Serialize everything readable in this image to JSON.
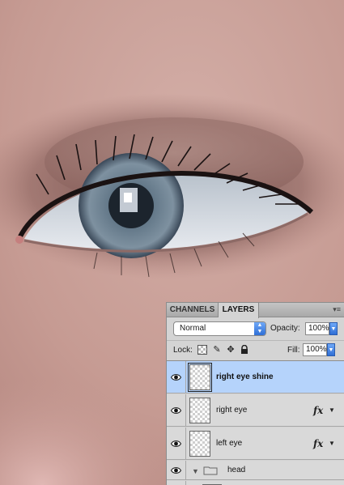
{
  "panel": {
    "tabs": [
      "CHANNELS",
      "LAYERS"
    ],
    "active_tab": "LAYERS",
    "blend_mode": "Normal",
    "opacity_label": "Opacity:",
    "opacity_value": "100%",
    "lock_label": "Lock:",
    "fill_label": "Fill:",
    "fill_value": "100%"
  },
  "layers": [
    {
      "name": "right eye shine",
      "selected": true,
      "visible": true,
      "has_fx": false
    },
    {
      "name": "right eye",
      "selected": false,
      "visible": true,
      "has_fx": true,
      "fx_label": "fx"
    },
    {
      "name": "left eye",
      "selected": false,
      "visible": true,
      "has_fx": true,
      "fx_label": "fx"
    },
    {
      "name": "head",
      "type": "group",
      "expanded": true,
      "visible": true
    }
  ],
  "colors": {
    "selection": "#b5d3fb",
    "panel_bg": "#d4d4d4",
    "accent_blue": "#2f6fd6"
  }
}
